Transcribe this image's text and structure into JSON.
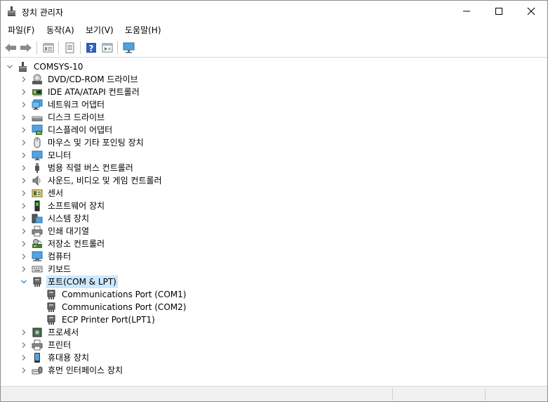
{
  "window": {
    "title": "장치 관리자",
    "controls": {
      "minimize": "—",
      "maximize": "☐",
      "close": "✕"
    }
  },
  "menu": {
    "items": [
      {
        "label": "파일(F)"
      },
      {
        "label": "동작(A)"
      },
      {
        "label": "보기(V)"
      },
      {
        "label": "도움말(H)"
      }
    ]
  },
  "toolbar": {
    "buttons": [
      "back-icon",
      "forward-icon",
      "properties-view-icon",
      "page-icon",
      "help-icon",
      "play-view-icon",
      "monitor-scan-icon"
    ]
  },
  "tree": {
    "root": {
      "label": "COMSYS-10",
      "expanded": true
    },
    "categories": [
      {
        "label": "DVD/CD-ROM 드라이브",
        "icon": "dvd-drive-icon",
        "expanded": false
      },
      {
        "label": "IDE ATA/ATAPI 컨트롤러",
        "icon": "ide-controller-icon",
        "expanded": false
      },
      {
        "label": "네트워크 어댑터",
        "icon": "network-adapter-icon",
        "expanded": false
      },
      {
        "label": "디스크 드라이브",
        "icon": "disk-drive-icon",
        "expanded": false
      },
      {
        "label": "디스플레이 어댑터",
        "icon": "display-adapter-icon",
        "expanded": false
      },
      {
        "label": "마우스 및 기타 포인팅 장치",
        "icon": "mouse-icon",
        "expanded": false
      },
      {
        "label": "모니터",
        "icon": "monitor-icon",
        "expanded": false
      },
      {
        "label": "범용 직렬 버스 컨트롤러",
        "icon": "usb-icon",
        "expanded": false
      },
      {
        "label": "사운드, 비디오 및 게임 컨트롤러",
        "icon": "speaker-icon",
        "expanded": false
      },
      {
        "label": "센서",
        "icon": "sensor-icon",
        "expanded": false
      },
      {
        "label": "소프트웨어 장치",
        "icon": "software-device-icon",
        "expanded": false
      },
      {
        "label": "시스템 장치",
        "icon": "system-device-icon",
        "expanded": false
      },
      {
        "label": "인쇄 대기열",
        "icon": "print-queue-icon",
        "expanded": false
      },
      {
        "label": "저장소 컨트롤러",
        "icon": "storage-controller-icon",
        "expanded": false
      },
      {
        "label": "컴퓨터",
        "icon": "computer-icon",
        "expanded": false
      },
      {
        "label": "키보드",
        "icon": "keyboard-icon",
        "expanded": false
      },
      {
        "label": "포트(COM & LPT)",
        "icon": "port-icon",
        "expanded": true,
        "children": [
          {
            "label": "Communications Port (COM1)",
            "icon": "port-icon"
          },
          {
            "label": "Communications Port (COM2)",
            "icon": "port-icon"
          },
          {
            "label": "ECP Printer Port(LPT1)",
            "icon": "port-icon"
          }
        ]
      },
      {
        "label": "프로세서",
        "icon": "processor-icon",
        "expanded": false
      },
      {
        "label": "프린터",
        "icon": "printer-icon",
        "expanded": false
      },
      {
        "label": "휴대용 장치",
        "icon": "portable-device-icon",
        "expanded": false
      },
      {
        "label": "휴먼 인터페이스 장치",
        "icon": "hid-icon",
        "expanded": false
      }
    ]
  },
  "colors": {
    "selection": "#cce8ff",
    "chevron_expanded": "#1e8fd6",
    "chevron_collapsed": "#707070"
  }
}
